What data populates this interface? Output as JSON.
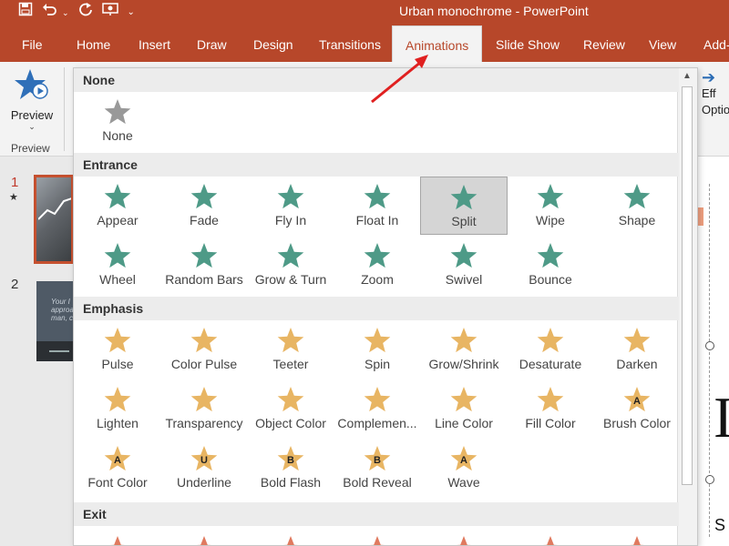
{
  "window": {
    "title": "Urban monochrome  -  PowerPoint",
    "brand_color": "#b7472a"
  },
  "qat_icons": [
    "save-icon",
    "undo-icon",
    "redo-icon",
    "present-icon",
    "customize-icon"
  ],
  "tabs": [
    {
      "label": "File"
    },
    {
      "label": "Home"
    },
    {
      "label": "Insert"
    },
    {
      "label": "Draw"
    },
    {
      "label": "Design"
    },
    {
      "label": "Transitions"
    },
    {
      "label": "Animations",
      "active": true
    },
    {
      "label": "Slide Show"
    },
    {
      "label": "Review"
    },
    {
      "label": "View"
    },
    {
      "label": "Add-"
    }
  ],
  "ribbon": {
    "preview_label": "Preview",
    "preview_group": "Preview",
    "effect_options_line1": "Eff",
    "effect_options_line2": "Optio"
  },
  "thumbs": {
    "slide1_num": "1",
    "slide2_num": "2",
    "slide2_text": "Your I\napproa\nman, c"
  },
  "slide_preview": {
    "big_char": "I",
    "small_char": "S"
  },
  "gallery": {
    "sections": [
      {
        "label": "None",
        "items": [
          {
            "label": "None"
          }
        ]
      },
      {
        "label": "Entrance",
        "items": [
          {
            "label": "Appear"
          },
          {
            "label": "Fade"
          },
          {
            "label": "Fly In"
          },
          {
            "label": "Float In"
          },
          {
            "label": "Split",
            "selected": true
          },
          {
            "label": "Wipe"
          },
          {
            "label": "Shape"
          },
          {
            "label": "Wheel"
          },
          {
            "label": "Random Bars"
          },
          {
            "label": "Grow & Turn"
          },
          {
            "label": "Zoom"
          },
          {
            "label": "Swivel"
          },
          {
            "label": "Bounce"
          }
        ]
      },
      {
        "label": "Emphasis",
        "items": [
          {
            "label": "Pulse"
          },
          {
            "label": "Color Pulse"
          },
          {
            "label": "Teeter"
          },
          {
            "label": "Spin"
          },
          {
            "label": "Grow/Shrink"
          },
          {
            "label": "Desaturate"
          },
          {
            "label": "Darken"
          },
          {
            "label": "Lighten"
          },
          {
            "label": "Transparency"
          },
          {
            "label": "Object Color"
          },
          {
            "label": "Complemen..."
          },
          {
            "label": "Line Color"
          },
          {
            "label": "Fill Color"
          },
          {
            "label": "Brush Color"
          },
          {
            "label": "Font Color"
          },
          {
            "label": "Underline"
          },
          {
            "label": "Bold Flash"
          },
          {
            "label": "Bold Reveal"
          },
          {
            "label": "Wave"
          }
        ]
      },
      {
        "label": "Exit",
        "items": []
      }
    ],
    "star_letters": {
      "Brush Color": "A",
      "Font Color": "A",
      "Underline": "U",
      "Bold Flash": "B",
      "Bold Reveal": "B",
      "Wave": "A"
    },
    "colors": {
      "entrance": "#4e9a87",
      "emphasis": "#e8b563",
      "exit": "#e07a5f",
      "none": "#999999",
      "annotation": "#e02020"
    }
  }
}
